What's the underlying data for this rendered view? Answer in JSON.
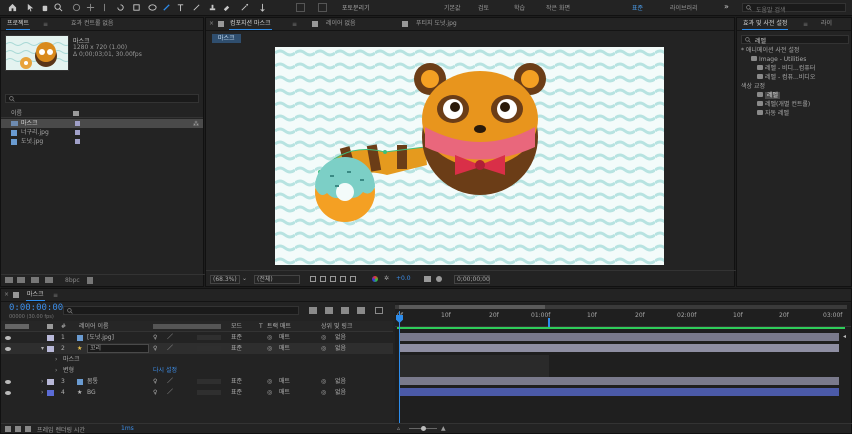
{
  "toolbar": {
    "icons": [
      "home-icon",
      "selection-arrow-icon",
      "hand-icon",
      "zoom-icon",
      "orbit-camera-icon",
      "pan-camera-icon",
      "dolly-camera-icon",
      "rotate-icon",
      "pan-behind-icon",
      "rectangle-icon",
      "pen-icon",
      "type-icon",
      "brush-icon",
      "clone-stamp-icon",
      "eraser-icon",
      "roto-brush-icon",
      "puppet-pin-icon"
    ],
    "snap_label": "포토분리기",
    "workspaces": [
      "기본값",
      "검토",
      "학습",
      "작은 화면",
      "표준",
      "라이브러리"
    ],
    "search_placeholder": "도움말 검색"
  },
  "project": {
    "tabs": [
      "프로젝트",
      "효과 컨트롤 없음"
    ],
    "item_name": "마스크",
    "item_dims": "1280 x 720 (1.00)",
    "item_duration": "Δ 0;00;03;01, 30.00fps",
    "search_placeholder": "",
    "col_name": "이름",
    "items": [
      {
        "name": "마스크",
        "type": "comp"
      },
      {
        "name": "너구리.jpg",
        "type": "image"
      },
      {
        "name": "도넛.jpg",
        "type": "image"
      }
    ],
    "footer_label": "8bpc"
  },
  "comp_panel": {
    "tabs": [
      "컴포지션 마스크",
      "레이어 없음",
      "푸티지 도넛.jpg"
    ],
    "breadcrumb": "마스크",
    "zoom": "(68.3%)",
    "resolution": "(전체)",
    "timecode": "0;00;00;00",
    "exposure": "+0.0"
  },
  "effects": {
    "tabs": [
      "효과 및 사전 설정",
      "라이"
    ],
    "search_value": "레벨",
    "tree": [
      {
        "label": "* 애니메이션 사전 설정",
        "indent": 0
      },
      {
        "label": "Image - Utilities",
        "indent": 1
      },
      {
        "label": "레벨 - 비디...컴퓨터",
        "indent": 2
      },
      {
        "label": "레벨 - 컴퓨...비디오",
        "indent": 2
      },
      {
        "label": "색상 교정",
        "indent": 0
      },
      {
        "label": "레벨",
        "indent": 2,
        "selected": true
      },
      {
        "label": "레벨(개별 컨트롤)",
        "indent": 2
      },
      {
        "label": "자동 레벨",
        "indent": 2
      }
    ]
  },
  "timeline": {
    "tab": "마스크",
    "timecode": "0:00:00:00",
    "time_sub": "00000 (30.00 fps)",
    "headers": {
      "num": "#",
      "layer_name": "레이어 이름",
      "mode": "모드",
      "t": "T",
      "trkmat": "트랙 매트",
      "parent": "상위 및 링크"
    },
    "layers": [
      {
        "num": "1",
        "name": "[도넛.jpg]",
        "mode": "표준",
        "matte": "매트",
        "parent": "없음",
        "color": "#b8b8d8",
        "icon": "img"
      },
      {
        "num": "2",
        "name": "꼬리",
        "mode": "표준",
        "matte": "매트",
        "parent": "없음",
        "color": "#b8b8d8",
        "icon": "star",
        "editing": true
      },
      {
        "sub": "마스크"
      },
      {
        "sub": "변형",
        "reset": "다시 설정"
      },
      {
        "num": "3",
        "name": "몸통",
        "mode": "표준",
        "matte": "매트",
        "parent": "없음",
        "color": "#b8b8d8",
        "icon": "img"
      },
      {
        "num": "4",
        "name": "BG",
        "mode": "표준",
        "matte": "매트",
        "parent": "없음",
        "color": "#5b6cd6",
        "icon": "star"
      }
    ],
    "ruler": [
      "0f",
      "10f",
      "20f",
      "01:00f",
      "10f",
      "20f",
      "02:00f",
      "10f",
      "20f",
      "03:00f"
    ],
    "footer": "프레임 렌더링 시간",
    "footer_value": "1ms"
  },
  "colors": {
    "accent": "#2d8ceb",
    "timeline_time": "#3d8ee8",
    "bg_layer": "#5b6cd6",
    "wave": "#b7e3e1"
  }
}
